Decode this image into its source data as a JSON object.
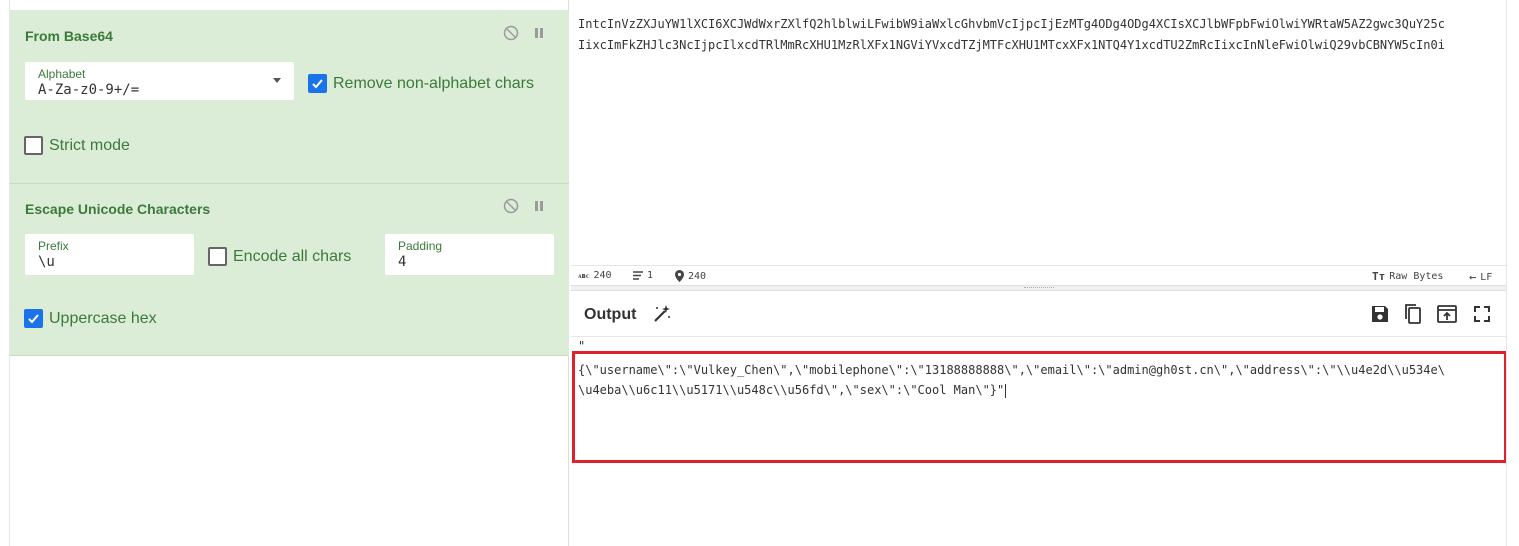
{
  "recipe": {
    "from_base64": {
      "title": "From Base64",
      "alphabet_label": "Alphabet",
      "alphabet_value": "A-Za-z0-9+/=",
      "remove_nonalpha_label": "Remove non-alphabet chars",
      "remove_nonalpha_checked": true,
      "strict_mode_label": "Strict mode",
      "strict_mode_checked": false
    },
    "escape_unicode": {
      "title": "Escape Unicode Characters",
      "prefix_label": "Prefix",
      "prefix_value": "\\u",
      "encode_all_label": "Encode all chars",
      "encode_all_checked": false,
      "padding_label": "Padding",
      "padding_value": "4",
      "uppercase_label": "Uppercase hex",
      "uppercase_checked": true
    }
  },
  "input": {
    "line1": "IntcInVzZXJuYW1lXCI6XCJWdWxrZXlfQ2hlblwiLFwibW9iaWxlcGhvbmVcIjpcIjEzMTg4ODg4ODg4XCIsXCJlbWFpbFwiOlwiYWRtaW5AZ2gwc3QuY25c",
    "line2": "IixcImFkZHJlc3NcIjpcIlxcdTRlMmRcXHU1MzRlXFx1NGViYVxcdTZjMTFcXHU1MTcxXFx1NTQ4Y1xcdTU2ZmRcIixcInNleFwiOlwiQ29vbCBNYW5cIn0i",
    "status": {
      "chars": "240",
      "lines": "1",
      "position": "240",
      "encoding": "Raw Bytes",
      "eol": "LF"
    }
  },
  "output": {
    "title": "Output",
    "quote": "\"",
    "line1": "{\\\"username\\\":\\\"Vulkey_Chen\\\",\\\"mobilephone\\\":\\\"13188888888\\\",\\\"email\\\":\\\"admin@gh0st.cn\\\",\\\"address\\\":\\\"\\\\u4e2d\\\\u534e\\",
    "line2": "\\u4eba\\\\u6c11\\\\u5171\\\\u548c\\\\u56fd\\\",\\\"sex\\\":\\\"Cool Man\\\"}\""
  },
  "colors": {
    "op_bg": "#dcedd7",
    "op_text": "#3b7a3b",
    "checkbox_on": "#1a73e8",
    "highlight": "#e0202a"
  },
  "icons": [
    "disable-icon",
    "pause-icon",
    "dropdown-caret-icon",
    "checkmark-icon",
    "abc-icon",
    "lines-icon",
    "location-pin-icon",
    "text-format-icon",
    "return-arrow-icon",
    "magic-wand-icon",
    "save-icon",
    "copy-icon",
    "replace-input-icon",
    "maximize-icon"
  ]
}
